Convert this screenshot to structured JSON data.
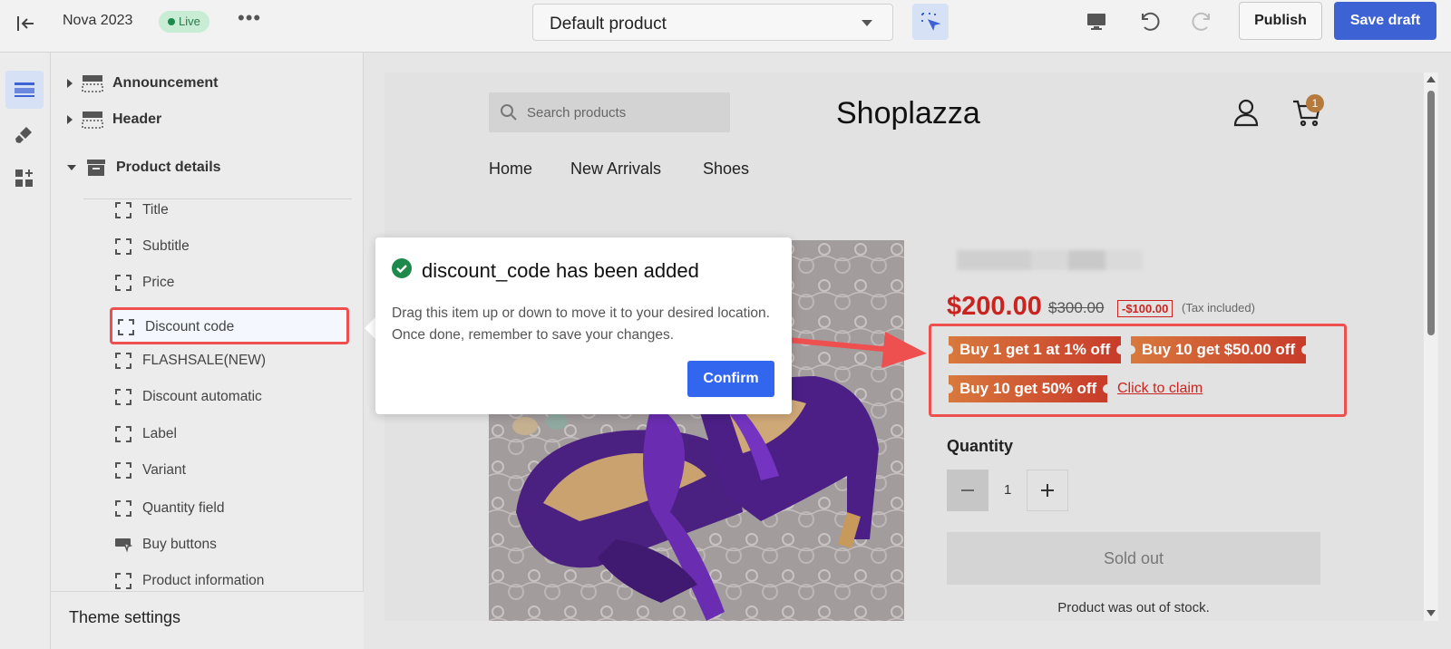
{
  "topbar": {
    "theme_name": "Nova 2023",
    "live_badge": "Live",
    "more": "•••",
    "template_select": "Default product",
    "publish_label": "Publish",
    "save_draft_label": "Save draft"
  },
  "sidebar": {
    "sections": [
      {
        "label": "Announcement"
      },
      {
        "label": "Header"
      },
      {
        "label": "Product details"
      }
    ],
    "blocks": [
      {
        "label": "Title"
      },
      {
        "label": "Subtitle"
      },
      {
        "label": "Price"
      },
      {
        "label": "Discount code"
      },
      {
        "label": "FLASHSALE(NEW)"
      },
      {
        "label": "Discount automatic"
      },
      {
        "label": "Label"
      },
      {
        "label": "Variant"
      },
      {
        "label": "Quantity field"
      },
      {
        "label": "Buy buttons"
      },
      {
        "label": "Product information"
      }
    ],
    "theme_settings": "Theme settings"
  },
  "store": {
    "search_placeholder": "Search products",
    "logo": "Shoplazza",
    "cart_count": "1",
    "nav": [
      "Home",
      "New Arrivals",
      "Shoes"
    ]
  },
  "product": {
    "price": "$200.00",
    "compare_price": "$300.00",
    "savings": "-$100.00",
    "tax_note": "(Tax included)",
    "discounts": [
      "Buy 1 get 1 at 1% off",
      "Buy 10 get $50.00 off",
      "Buy 10 get 50% off"
    ],
    "claim_link": "Click to claim",
    "quantity_label": "Quantity",
    "quantity_value": "1",
    "sold_out_label": "Sold out",
    "stock_note": "Product was out of stock."
  },
  "dialog": {
    "title": "discount_code has been added",
    "description": "Drag this item up or down to move it to your desired location. Once done, remember to save your changes.",
    "confirm_label": "Confirm"
  },
  "colors": {
    "accent": "#3d62d4",
    "highlight": "#ee4f4f",
    "price": "#c9241f",
    "success": "#1d8a4c"
  }
}
